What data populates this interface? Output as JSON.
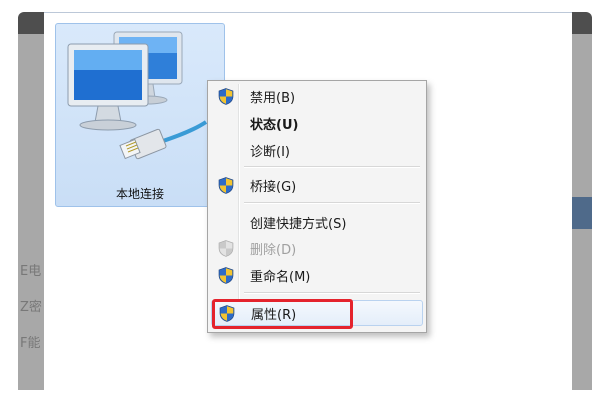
{
  "adapter": {
    "name": "本地连接"
  },
  "background_glyphs": [
    "E电",
    "Z密",
    "F能"
  ],
  "context_menu": {
    "items": [
      {
        "label": "禁用(B)",
        "icon": "uac-shield-icon",
        "bold": false,
        "disabled": false
      },
      {
        "label": "状态(U)",
        "icon": "",
        "bold": true,
        "disabled": false
      },
      {
        "label": "诊断(I)",
        "icon": "",
        "bold": false,
        "disabled": false
      },
      {
        "label": "桥接(G)",
        "icon": "uac-shield-icon",
        "bold": false,
        "disabled": false
      },
      {
        "label": "创建快捷方式(S)",
        "icon": "",
        "bold": false,
        "disabled": false
      },
      {
        "label": "删除(D)",
        "icon": "uac-shield-icon",
        "bold": false,
        "disabled": true
      },
      {
        "label": "重命名(M)",
        "icon": "uac-shield-icon",
        "bold": false,
        "disabled": false
      },
      {
        "label": "属性(R)",
        "icon": "uac-shield-icon",
        "bold": false,
        "disabled": false,
        "highlighted": true
      }
    ]
  },
  "colors": {
    "highlight_box": "#e4232d",
    "tile_selected": "#c9def6",
    "backdrop": "#4e4e4e"
  }
}
